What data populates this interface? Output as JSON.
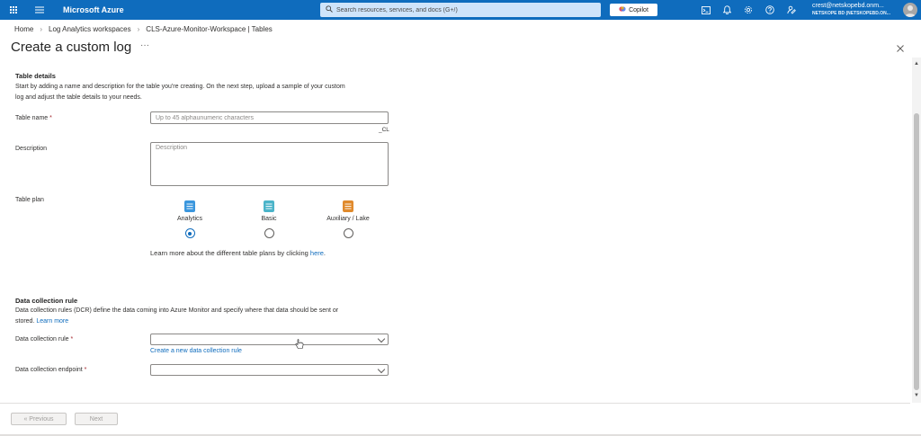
{
  "topbar": {
    "brand": "Microsoft Azure",
    "search_placeholder": "Search resources, services, and docs (G+/)",
    "copilot_label": "Copilot",
    "account_email": "crest@netskopebd.onm...",
    "account_tenant": "NETSKOPE BD (NETSKOPEBD.ON..."
  },
  "breadcrumb": {
    "items": [
      "Home",
      "Log Analytics workspaces",
      "CLS-Azure-Monitor-Workspace | Tables"
    ]
  },
  "page": {
    "title": "Create a custom log",
    "more": "···"
  },
  "table_details": {
    "heading": "Table details",
    "description_line1": "Start by adding a name and description for the table you're creating. On the next step, upload a sample of your custom",
    "description_line2": "log and adjust the table details to your needs.",
    "table_name_label": "Table name",
    "required_mark": "*",
    "table_name_placeholder": "Up to 45 alphaunumeric characters",
    "table_name_suffix": "_CL",
    "description_label": "Description",
    "description_placeholder": "Description",
    "table_plan_label": "Table plan",
    "plans": [
      {
        "label": "Analytics",
        "selected": true,
        "color": "#3a96dd"
      },
      {
        "label": "Basic",
        "selected": false,
        "color": "#4bb4c9"
      },
      {
        "label": "Auxiliary / Lake",
        "selected": false,
        "color": "#e08a2c"
      }
    ],
    "learn_more_text": "Learn more about the different table plans by clicking",
    "learn_more_link": "here",
    "learn_more_end": "."
  },
  "dcr": {
    "heading": "Data collection rule",
    "description_line1": "Data collection rules (DCR) define the data coming into Azure Monitor and specify where that data should be sent or",
    "description_line2_prefix": "stored.",
    "learn_more": "Learn more",
    "rule_label": "Data collection rule",
    "create_new_link": "Create a new data collection rule",
    "endpoint_label": "Data collection endpoint",
    "required_mark": "*"
  },
  "footer": {
    "previous": "« Previous",
    "next": "Next"
  },
  "colors": {
    "topbar": "#0f6cbd",
    "link": "#0f6cbd",
    "required": "#a4262c"
  }
}
